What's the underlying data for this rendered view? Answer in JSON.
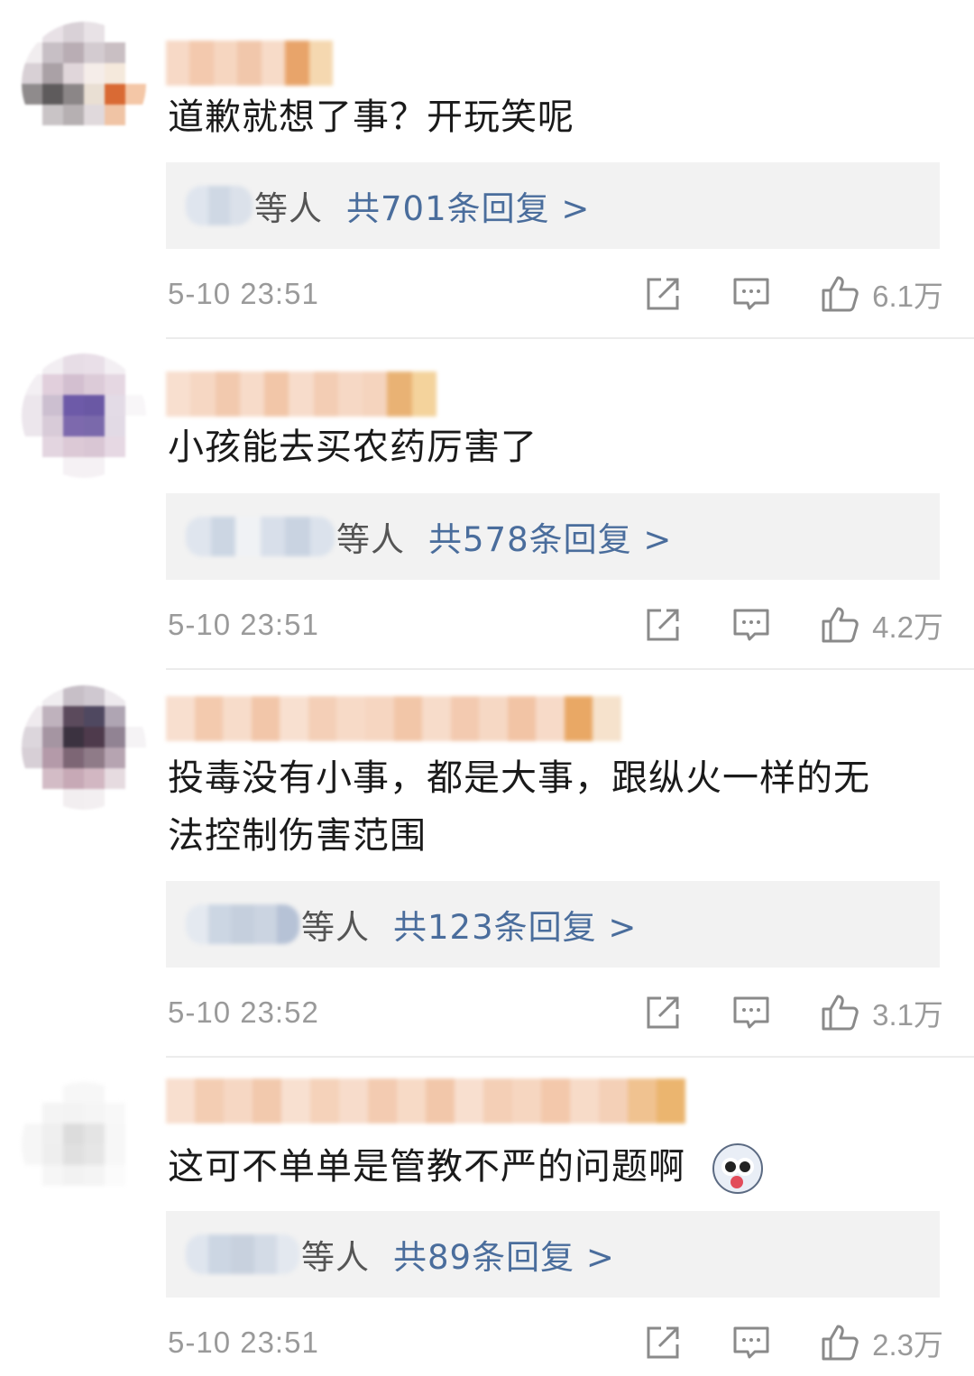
{
  "comments": [
    {
      "text": "道歉就想了事？开玩笑呢",
      "reply_suffix": "等人",
      "reply_count": "共701条回复 >",
      "time": "5-10 23:51",
      "likes": "6.1万"
    },
    {
      "text": "小孩能去买农药厉害了",
      "reply_suffix": "等人",
      "reply_count": "共578条回复 >",
      "time": "5-10 23:51",
      "likes": "4.2万"
    },
    {
      "text_line1": "投毒没有小事，都是大事，跟纵火一样的无",
      "text_line2": "法控制伤害范围",
      "reply_suffix": "等人",
      "reply_count": "共123条回复 >",
      "time": "5-10 23:52",
      "likes": "3.1万"
    },
    {
      "text": "这可不单单是管教不严的问题啊",
      "emoji": "husky-emoji",
      "reply_suffix": "等人",
      "reply_count": "共89条回复 >",
      "time": "5-10 23:51",
      "likes": "2.3万"
    }
  ],
  "icons": {
    "share": "share-icon",
    "comment": "comment-icon",
    "like": "thumbs-up-icon"
  },
  "colors": {
    "reply_link": "#4a6d9c",
    "meta_gray": "#9a9a9a",
    "reply_box_bg": "#f2f2f2"
  }
}
